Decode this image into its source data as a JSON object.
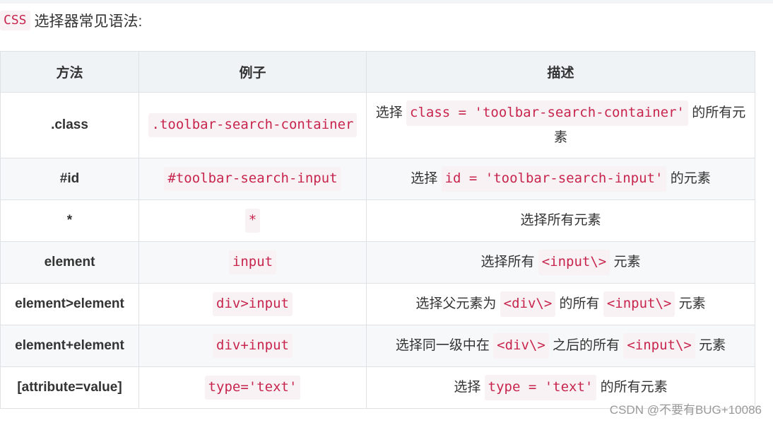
{
  "heading": {
    "code": "CSS",
    "text": "选择器常见语法:"
  },
  "table": {
    "headers": [
      "方法",
      "例子",
      "描述"
    ],
    "rows": [
      {
        "method": ".class",
        "example": ".toolbar-search-container",
        "desc_before": "选择 ",
        "desc_code": "class = 'toolbar-search-container'",
        "desc_after": " 的所有元素"
      },
      {
        "method": "#id",
        "example": "#toolbar-search-input",
        "desc_before": "选择 ",
        "desc_code": "id = 'toolbar-search-input'",
        "desc_after": " 的元素"
      },
      {
        "method": "*",
        "example": "*",
        "desc_text": "选择所有元素"
      },
      {
        "method": "element",
        "example": "input",
        "desc_before": "选择所有 ",
        "desc_code": "<input\\>",
        "desc_after": " 元素"
      },
      {
        "method": "element>element",
        "example": "div>input",
        "desc_before": "选择父元素为 ",
        "desc_code": "<div\\>",
        "desc_mid": " 的所有 ",
        "desc_code2": "<input\\>",
        "desc_after": " 元素"
      },
      {
        "method": "element+element",
        "example": "div+input",
        "desc_before": "选择同一级中在 ",
        "desc_code": "<div\\>",
        "desc_mid": " 之后的所有 ",
        "desc_code2": "<input\\>",
        "desc_after": " 元素"
      },
      {
        "method": "[attribute=value]",
        "example": "type='text'",
        "desc_before": "选择 ",
        "desc_code": "type = 'text'",
        "desc_after": " 的所有元素"
      }
    ]
  },
  "watermark": "CSDN @不要有BUG+10086",
  "colors": {
    "code_text": "#c7254e",
    "code_bg": "#f9f2f4",
    "header_bg": "#eff3f5",
    "border": "#dfe2e5"
  }
}
